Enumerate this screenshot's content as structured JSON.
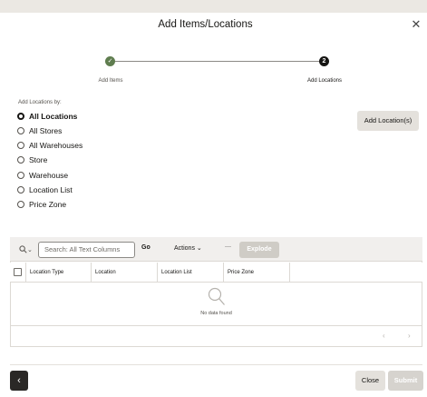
{
  "dialog": {
    "title": "Add Items/Locations",
    "close_icon": "close-icon",
    "close_glyph": "✕"
  },
  "stepper": {
    "steps": [
      {
        "label": "Add Items",
        "state": "completed",
        "glyph": "✓"
      },
      {
        "label": "Add Locations",
        "state": "current",
        "glyph": "2"
      }
    ]
  },
  "locations_form": {
    "caption": "Add Locations by:",
    "options": [
      {
        "label": "All Locations",
        "selected": true
      },
      {
        "label": "All Stores",
        "selected": false
      },
      {
        "label": "All Warehouses",
        "selected": false
      },
      {
        "label": "Store",
        "selected": false
      },
      {
        "label": "Warehouse",
        "selected": false
      },
      {
        "label": "Location List",
        "selected": false
      },
      {
        "label": "Price Zone",
        "selected": false
      }
    ],
    "add_button": "Add Location(s)"
  },
  "table": {
    "search": {
      "placeholder": "Search: All Text Columns",
      "icon": "search-icon",
      "chevron": "⌄"
    },
    "go_label": "Go",
    "actions_label": "Actions",
    "actions_chevron": "⌄",
    "divider": "—",
    "explode_label": "Explode",
    "columns": [
      "Location Type",
      "Location",
      "Location List",
      "Price Zone"
    ],
    "empty_message": "No data found",
    "pager": {
      "prev": "‹",
      "next": "›"
    }
  },
  "footer": {
    "back_icon": "chevron-left-icon",
    "back_glyph": "‹",
    "close_label": "Close",
    "submit_label": "Submit"
  },
  "colors": {
    "completed_step": "#5f7d4f",
    "current_step": "#161513",
    "back_button": "#2a2826",
    "disabled_button": "#d6d3ce"
  }
}
